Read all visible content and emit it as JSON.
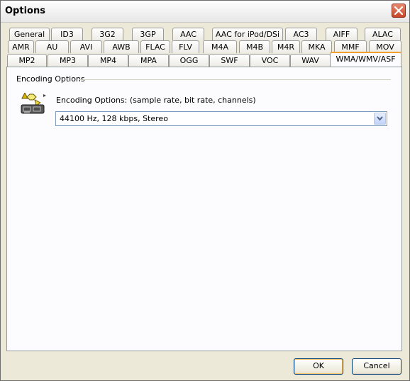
{
  "window": {
    "title": "Options"
  },
  "tabs": {
    "row1": [
      "General",
      "ID3",
      "3G2",
      "3GP",
      "AAC",
      "AAC for iPod/DSi",
      "AC3",
      "AIFF",
      "ALAC"
    ],
    "row2": [
      "AMR",
      "AU",
      "AVI",
      "AWB",
      "FLAC",
      "FLV",
      "M4A",
      "M4B",
      "M4R",
      "MKA",
      "MMF",
      "MOV"
    ],
    "row3": [
      "MP2",
      "MP3",
      "MP4",
      "MPA",
      "OGG",
      "SWF",
      "VOC",
      "WAV",
      "WMA/WMV/ASF"
    ],
    "active": "WMA/WMV/ASF"
  },
  "panel": {
    "group_label": "Encoding Options",
    "encoding_label": "Encoding Options: (sample rate, bit rate, channels)",
    "encoding_value": "44100 Hz, 128 kbps, Stereo"
  },
  "buttons": {
    "ok": "OK",
    "cancel": "Cancel"
  },
  "icons": {
    "close": "close-icon",
    "encoder": "encoder-icon",
    "dropdown": "chevron-down-icon"
  }
}
